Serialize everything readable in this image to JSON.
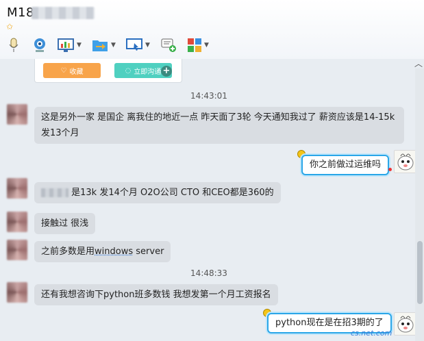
{
  "window": {
    "title_prefix": "M18"
  },
  "toolbar": {
    "icons": [
      "microphone-icon",
      "webcam-icon",
      "screen-share-icon",
      "folder-transfer-icon",
      "remote-desktop-icon",
      "chat-add-icon",
      "apps-icon"
    ]
  },
  "card": {
    "favorite_label": "收藏",
    "chat_now_label": "立即沟通"
  },
  "messages": {
    "ts1": "14:43:01",
    "m1_line1": "这是另外一家 是国企 离我住的地近一点  昨天面了3轮 今天通知我过了  薪资应该是14-15k",
    "m1_line2": "发13个月",
    "r1": "你之前做过运维吗",
    "m2": "是13k 发14个月  O2O公司  CTO 和CEO都是360的",
    "m3": "接触过  很浅",
    "m4_pre": "之前多数是用",
    "m4_link": "windows",
    "m4_post": " server",
    "ts2": "14:48:33",
    "m5": "还有我想咨询下python班多数钱 我想发第一个月工资报名",
    "r2": "python现在是在招3期的了"
  },
  "watermark": "cs.net.com",
  "colors": {
    "accent": "#2aa6e8",
    "fav": "#f8a44a",
    "chat": "#4fd0c0"
  }
}
